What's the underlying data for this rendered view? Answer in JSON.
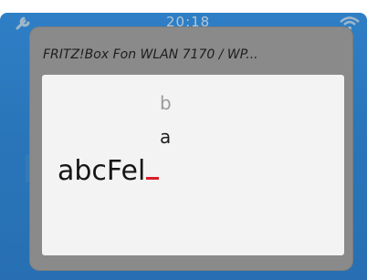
{
  "statusbar": {
    "left_icon": "wrench-icon",
    "time": "20:18",
    "right_icon": "wifi-icon"
  },
  "dialog": {
    "title": "FRITZ!Box Fon WLAN 7170 / WP...",
    "candidates": [
      "b",
      "a"
    ],
    "input_text": "abcFel",
    "cursor_color": "#d81e2a"
  },
  "colors": {
    "background_blue": "#2a76bb",
    "dialog_frame": "#8a8a8a",
    "dialog_body": "#f3f3f3"
  }
}
